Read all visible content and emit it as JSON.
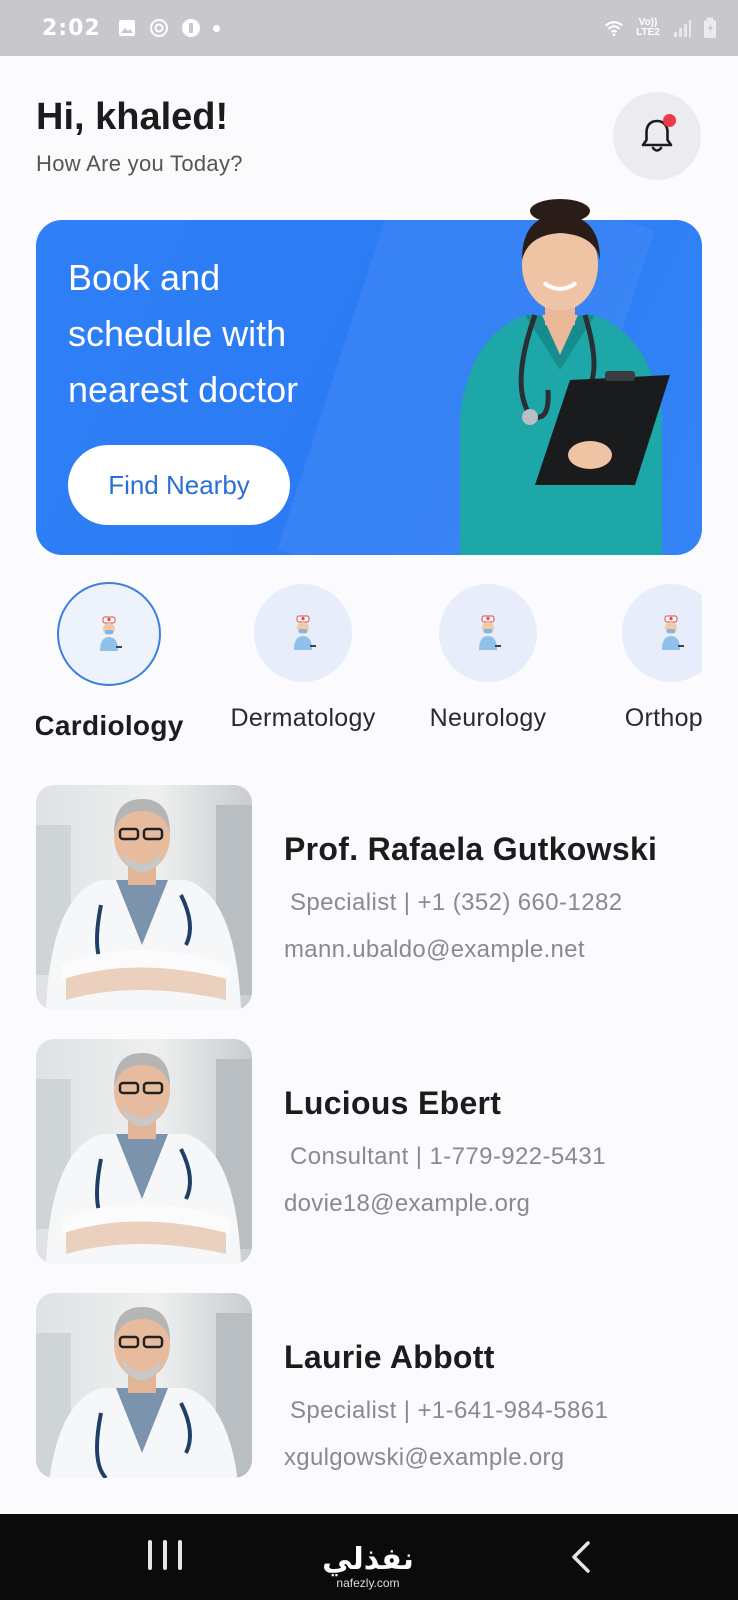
{
  "status_bar": {
    "time": "2:02",
    "network": "Vo)) LTE2"
  },
  "header": {
    "greeting": "Hi, khaled!",
    "subtitle": "How Are you Today?"
  },
  "banner": {
    "title": "Book and schedule with nearest doctor",
    "button_label": "Find Nearby"
  },
  "categories": [
    {
      "label": "Cardiology",
      "selected": true
    },
    {
      "label": "Dermatology",
      "selected": false
    },
    {
      "label": "Neurology",
      "selected": false
    },
    {
      "label": "Orthope",
      "selected": false
    }
  ],
  "doctors": [
    {
      "name": "Prof. Rafaela Gutkowski",
      "info": "Specialist | +1 (352) 660-1282",
      "email": "mann.ubaldo@example.net"
    },
    {
      "name": "Lucious Ebert",
      "info": "Consultant | 1-779-922-5431",
      "email": "dovie18@example.org"
    },
    {
      "name": "Laurie Abbott",
      "info": "Specialist | +1-641-984-5861",
      "email": "xgulgowski@example.org"
    }
  ],
  "nav": {
    "brand": "نفذلي",
    "url": "nafezly.com"
  },
  "colors": {
    "primary": "#2f7ff6",
    "badge": "#f0384b",
    "muted_text": "#8a8a8e"
  }
}
